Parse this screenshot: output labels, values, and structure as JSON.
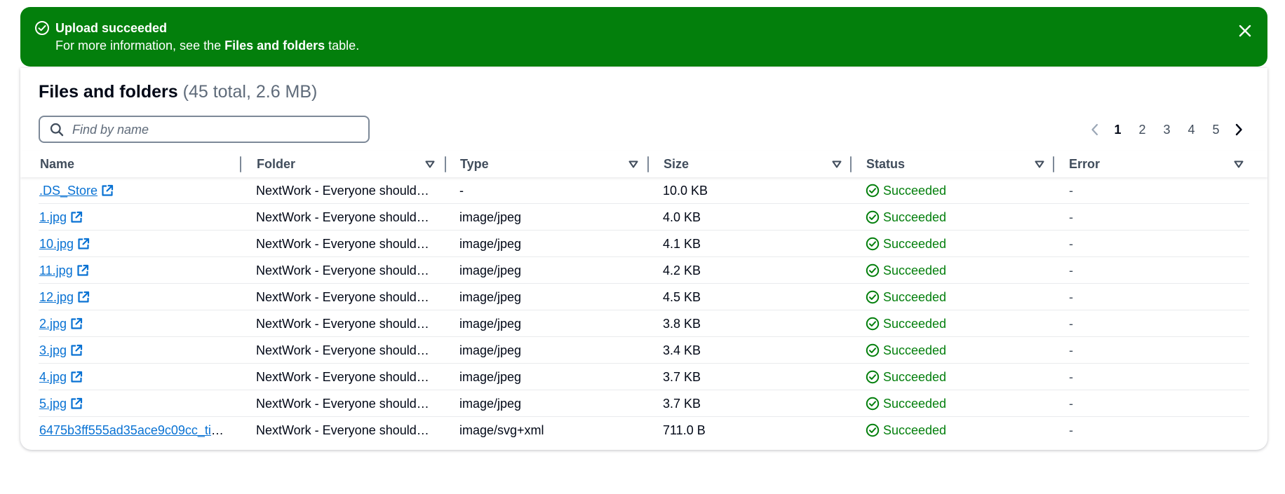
{
  "flash": {
    "title": "Upload succeeded",
    "message_prefix": "For more information, see the ",
    "message_link": "Files and folders",
    "message_suffix": " table.",
    "icon": "check-circle-icon",
    "close_icon": "close-icon",
    "color": "#037f0c"
  },
  "table": {
    "title": "Files and folders",
    "counter": "(45 total, 2.6 MB)",
    "search_placeholder": "Find by name",
    "pagination": {
      "pages": [
        "1",
        "2",
        "3",
        "4",
        "5"
      ],
      "current": "1"
    },
    "columns": [
      "Name",
      "Folder",
      "Type",
      "Size",
      "Status",
      "Error"
    ],
    "rows": [
      {
        "name": ".DS_Store",
        "folder": "NextWork - Everyone should…",
        "type": "-",
        "size": "10.0 KB",
        "status": "Succeeded",
        "error": "-"
      },
      {
        "name": "1.jpg",
        "folder": "NextWork - Everyone should…",
        "type": "image/jpeg",
        "size": "4.0 KB",
        "status": "Succeeded",
        "error": "-"
      },
      {
        "name": "10.jpg",
        "folder": "NextWork - Everyone should…",
        "type": "image/jpeg",
        "size": "4.1 KB",
        "status": "Succeeded",
        "error": "-"
      },
      {
        "name": "11.jpg",
        "folder": "NextWork - Everyone should…",
        "type": "image/jpeg",
        "size": "4.2 KB",
        "status": "Succeeded",
        "error": "-"
      },
      {
        "name": "12.jpg",
        "folder": "NextWork - Everyone should…",
        "type": "image/jpeg",
        "size": "4.5 KB",
        "status": "Succeeded",
        "error": "-"
      },
      {
        "name": "2.jpg",
        "folder": "NextWork - Everyone should…",
        "type": "image/jpeg",
        "size": "3.8 KB",
        "status": "Succeeded",
        "error": "-"
      },
      {
        "name": "3.jpg",
        "folder": "NextWork - Everyone should…",
        "type": "image/jpeg",
        "size": "3.4 KB",
        "status": "Succeeded",
        "error": "-"
      },
      {
        "name": "4.jpg",
        "folder": "NextWork - Everyone should…",
        "type": "image/jpeg",
        "size": "3.7 KB",
        "status": "Succeeded",
        "error": "-"
      },
      {
        "name": "5.jpg",
        "folder": "NextWork - Everyone should…",
        "type": "image/jpeg",
        "size": "3.7 KB",
        "status": "Succeeded",
        "error": "-"
      },
      {
        "name": "6475b3ff555ad35ace9c09cc_ti…",
        "folder": "NextWork - Everyone should…",
        "type": "image/svg+xml",
        "size": "711.0 B",
        "status": "Succeeded",
        "error": "-"
      }
    ]
  },
  "colors": {
    "success": "#037f0c",
    "link": "#0972d3",
    "text": "#000716",
    "muted": "#5f6b7a"
  }
}
